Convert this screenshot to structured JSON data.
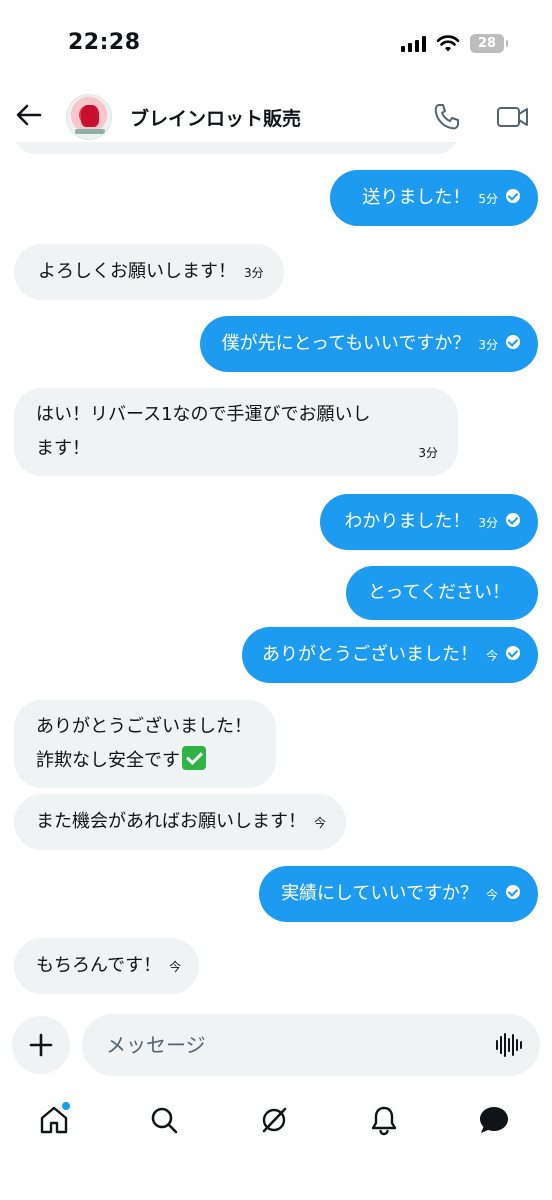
{
  "status_bar": {
    "time": "22:28",
    "battery": "28"
  },
  "header": {
    "contact_name": "ブレインロット販売"
  },
  "messages": [
    {
      "dir": "in",
      "text": "",
      "time": ""
    },
    {
      "dir": "out",
      "text": "送りました！",
      "time": "5分",
      "read": true
    },
    {
      "dir": "in",
      "text": "よろしくお願いします！",
      "time": "3分"
    },
    {
      "dir": "out",
      "text": "僕が先にとってもいいですか？",
      "time": "3分",
      "read": true
    },
    {
      "dir": "in",
      "line1": "はい！リバース1なので手運びでお願いし",
      "line2": "ます！",
      "time": "3分"
    },
    {
      "dir": "out",
      "text": "わかりました！",
      "time": "3分",
      "read": true
    },
    {
      "dir": "out",
      "text": "とってください！",
      "time": ""
    },
    {
      "dir": "out",
      "text": "ありがとうございました！",
      "time": "今",
      "read": true
    },
    {
      "dir": "in",
      "line1": "ありがとうございました！",
      "line2": "詐欺なし安全です",
      "emoji": "check-mark-button-emoji",
      "time": ""
    },
    {
      "dir": "in",
      "text": "また機会があればお願いします！",
      "time": "今"
    },
    {
      "dir": "out",
      "text": "実績にしていいですか？",
      "time": "今",
      "read": true
    },
    {
      "dir": "in",
      "text": "もちろんです！",
      "time": "今"
    }
  ],
  "composer": {
    "placeholder": "メッセージ"
  },
  "nav": {
    "items": [
      "home-icon",
      "search-icon",
      "grok-icon",
      "bell-icon",
      "messages-icon"
    ],
    "home_has_badge": true
  },
  "colors": {
    "accent": "#1d9bf0",
    "incoming_bg": "#eff3f4",
    "text": "#0f1419"
  }
}
